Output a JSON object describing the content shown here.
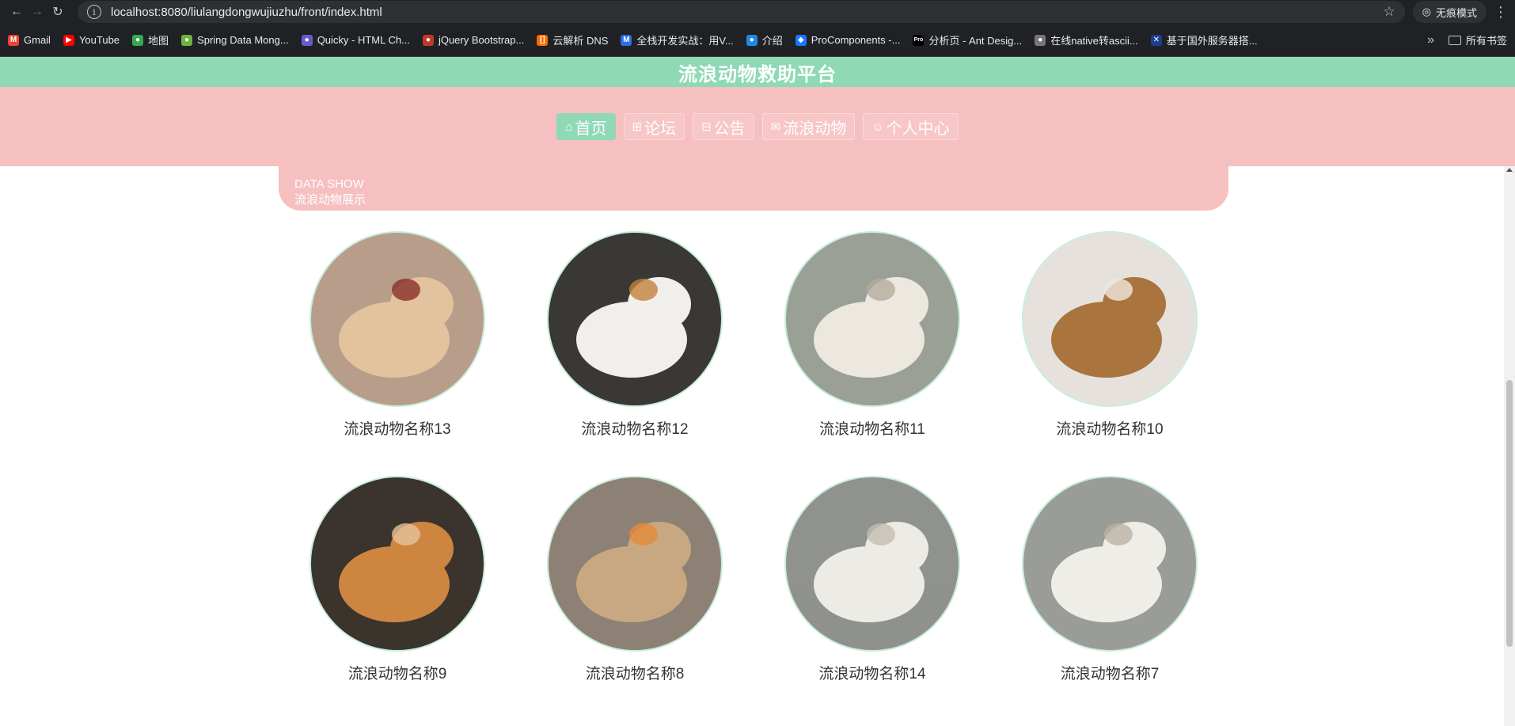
{
  "browser": {
    "url": "localhost:8080/liulangdongwujiuzhu/front/index.html",
    "incognito_label": "无痕模式",
    "all_bookmarks_label": "所有书签",
    "bookmarks": [
      {
        "label": "Gmail",
        "color": "#ea4335",
        "glyph": "M"
      },
      {
        "label": "YouTube",
        "color": "#ff0000",
        "glyph": "▶"
      },
      {
        "label": "地图",
        "color": "#34a853",
        "glyph": "●"
      },
      {
        "label": "Spring Data Mong...",
        "color": "#6db33f",
        "glyph": "●"
      },
      {
        "label": "Quicky - HTML Ch...",
        "color": "#6a5acd",
        "glyph": "●"
      },
      {
        "label": "jQuery Bootstrap...",
        "color": "#c0392b",
        "glyph": "●"
      },
      {
        "label": "云解析 DNS",
        "color": "#ff6a00",
        "glyph": "[]"
      },
      {
        "label": "全栈开发实战：用V...",
        "color": "#2b6de5",
        "glyph": "M"
      },
      {
        "label": "介绍",
        "color": "#1e88e5",
        "glyph": "●"
      },
      {
        "label": "ProComponents -...",
        "color": "#1677ff",
        "glyph": "◆"
      },
      {
        "label": "分析页 - Ant Desig...",
        "color": "#000000",
        "glyph": "Pro"
      },
      {
        "label": "在线native转ascii...",
        "color": "#777777",
        "glyph": "●"
      },
      {
        "label": "基于国外服务器搭...",
        "color": "#1d3e8f",
        "glyph": "✕"
      }
    ]
  },
  "site": {
    "title": "流浪动物救助平台",
    "nav": [
      {
        "label": "首页",
        "icon": "home-icon",
        "glyph": "⌂",
        "active": true
      },
      {
        "label": "论坛",
        "icon": "book-icon",
        "glyph": "⊞",
        "active": false
      },
      {
        "label": "公告",
        "icon": "gift-icon",
        "glyph": "⊟",
        "active": false
      },
      {
        "label": "流浪动物",
        "icon": "mail-icon",
        "glyph": "✉",
        "active": false
      },
      {
        "label": "个人中心",
        "icon": "user-icon",
        "glyph": "☺",
        "active": false
      }
    ]
  },
  "section": {
    "en": "DATA SHOW",
    "cn": "流浪动物展示"
  },
  "pets": [
    {
      "name": "流浪动物名称13",
      "bg": "#b89d8a",
      "main": "#e2c39d",
      "accent": "#8b2f2a"
    },
    {
      "name": "流浪动物名称12",
      "bg": "#3a3834",
      "main": "#f1efeb",
      "accent": "#c4823c"
    },
    {
      "name": "流浪动物名称11",
      "bg": "#9aa096",
      "main": "#ece8e0",
      "accent": "#b5ab9c"
    },
    {
      "name": "流浪动物名称10",
      "bg": "#e6e1dc",
      "main": "#a9743e",
      "accent": "#f0e9df"
    },
    {
      "name": "流浪动物名称9",
      "bg": "#3b342e",
      "main": "#cd8540",
      "accent": "#e6c29a"
    },
    {
      "name": "流浪动物名称8",
      "bg": "#8d8175",
      "main": "#c8a880",
      "accent": "#e58a3a"
    },
    {
      "name": "流浪动物名称14",
      "bg": "#8f928d",
      "main": "#ecebe6",
      "accent": "#c5bdb3"
    },
    {
      "name": "流浪动物名称7",
      "bg": "#9a9d97",
      "main": "#efede7",
      "accent": "#bcb2a5"
    }
  ]
}
